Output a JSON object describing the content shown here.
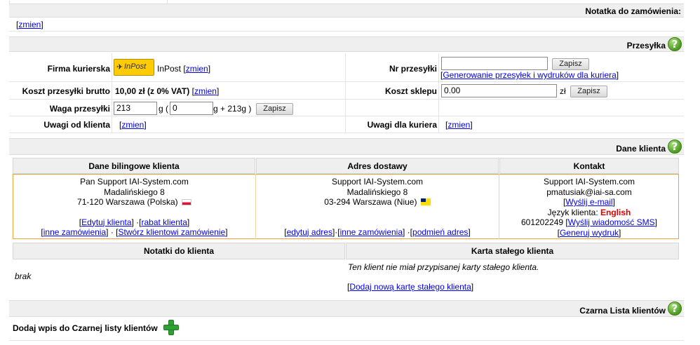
{
  "note_section": {
    "title": "Notatka do zamówienia:",
    "edit_link": "zmien"
  },
  "shipment": {
    "title": "Przesyłka",
    "courier_label": "Firma kurierska",
    "courier_logo_text": "InPost",
    "courier_name": "InPost",
    "courier_edit": "zmien",
    "cost_label": "Koszt przesyłki brutto",
    "cost_value": "10,00 zł (z 0% VAT)",
    "cost_edit": "zmien",
    "weight_label": "Waga przesyłki",
    "weight_value": "213",
    "weight_unit_open": "g (",
    "weight_extra_value": "0",
    "weight_suffix": "g + 213g )",
    "weight_save": "Zapisz",
    "client_notes_label": "Uwagi od klienta",
    "client_notes_edit": "zmien",
    "tracking_label": "Nr przesyłki",
    "tracking_value": "",
    "tracking_save": "Zapisz",
    "generate_link": "Generowanie przesyłek i wydruków dla kuriera",
    "shop_cost_label": "Koszt sklepu",
    "shop_cost_value": "0.00",
    "shop_cost_currency": "zł",
    "shop_cost_save": "Zapisz",
    "courier_notes_label": "Uwagi dla kuriera",
    "courier_notes_edit": "zmien"
  },
  "client": {
    "title": "Dane klienta",
    "billing": {
      "header": "Dane bilingowe klienta",
      "name": "Pan Support IAI-System.com",
      "street": "Madalińskiego 8",
      "city": "71-120 Warszawa (Polska)",
      "edit_link": "Edytuj klienta",
      "discount_link": "rabat klienta",
      "other_orders_link": "inne zamówienia",
      "create_order_link": "Stwórz klientowi zamówienie",
      "flag_colors": [
        "#ffffff",
        "#dc143c"
      ]
    },
    "delivery": {
      "header": "Adres dostawy",
      "name": "Support IAI-System.com",
      "street": "Madalińskiego 8",
      "city": "03-294 Warszawa (Niue)",
      "edit_link": "edytuj adres",
      "other_orders_link": "inne zamówienia",
      "replace_link": "podmień adres",
      "flag_colors": [
        "#fedd00",
        "#012169"
      ]
    },
    "contact": {
      "header": "Kontakt",
      "name": "Support IAI-System.com",
      "email": "pmatusiak@iai-sa.com",
      "send_email_link": "Wyślij e-mail",
      "language_label": "Język klienta:",
      "language_value": "English",
      "phone": "601202249",
      "send_sms_link": "Wyślij wiadomość SMS",
      "print_link": "Generuj wydruk"
    }
  },
  "notes": {
    "notes_header": "Notatki do klienta",
    "notes_value": "brak",
    "card_header": "Karta stałego klienta",
    "card_text": "Ten klient nie miał przypisanej karty stałego klienta.",
    "add_card_link": "Dodaj nową kartę stałego klienta"
  },
  "blacklist": {
    "title": "Czarna Lista klientów",
    "add_label": "Dodaj wpis do Czarnej listy klientów"
  },
  "colors": {
    "section_bg": "#efefef",
    "frame_orange": "#e8a33a",
    "link": "#0000ee",
    "language_red": "#e00000",
    "inpost_yellow": "#ffcb05"
  },
  "icons": {
    "help": "help-icon",
    "add": "plus-icon"
  }
}
